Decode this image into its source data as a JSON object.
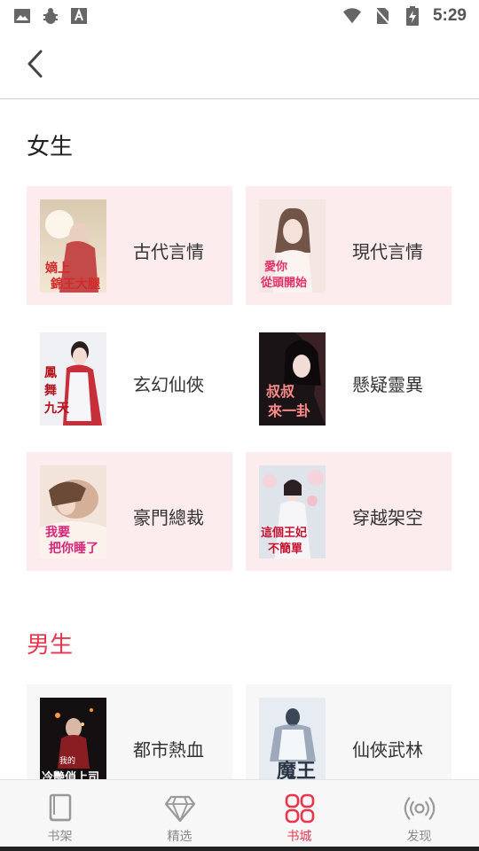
{
  "status_bar": {
    "time": "5:29",
    "left_icons": [
      "image-icon",
      "bug-icon",
      "font-a-icon"
    ],
    "right_icons": [
      "wifi-icon",
      "no-sim-icon",
      "battery-charging-icon"
    ]
  },
  "header": {
    "back_icon": "chevron-left-icon"
  },
  "sections": {
    "female": {
      "title": "女生",
      "color": "#222222",
      "cards": [
        {
          "label": "古代言情",
          "cover_text": "嫡上 錦王大腿",
          "bg": "#fcecee"
        },
        {
          "label": "現代言情",
          "cover_text": "愛你 從頭開始",
          "bg": "#fcecee"
        },
        {
          "label": "玄幻仙俠",
          "cover_text": "鳳舞九天",
          "bg": "#ffffff"
        },
        {
          "label": "懸疑靈異",
          "cover_text": "叔叔來一卦",
          "bg": "#ffffff"
        },
        {
          "label": "豪門總裁",
          "cover_text": "我要把你睡了",
          "bg": "#fcecee"
        },
        {
          "label": "穿越架空",
          "cover_text": "這個王妃不簡單",
          "bg": "#fcecee"
        }
      ]
    },
    "male": {
      "title": "男生",
      "color": "#e8364f",
      "cards": [
        {
          "label": "都市熱血",
          "cover_text": "我的冷艷俏上司",
          "bg": "#f7f7f7"
        },
        {
          "label": "仙俠武林",
          "cover_text": "魔王",
          "bg": "#f7f7f7"
        }
      ]
    }
  },
  "bottom_nav": {
    "active_color": "#e8364f",
    "items": [
      {
        "label": "书架",
        "icon": "book-icon",
        "active": false
      },
      {
        "label": "精选",
        "icon": "diamond-icon",
        "active": false
      },
      {
        "label": "书城",
        "icon": "grid-icon",
        "active": true
      },
      {
        "label": "发现",
        "icon": "broadcast-icon",
        "active": false
      }
    ]
  }
}
